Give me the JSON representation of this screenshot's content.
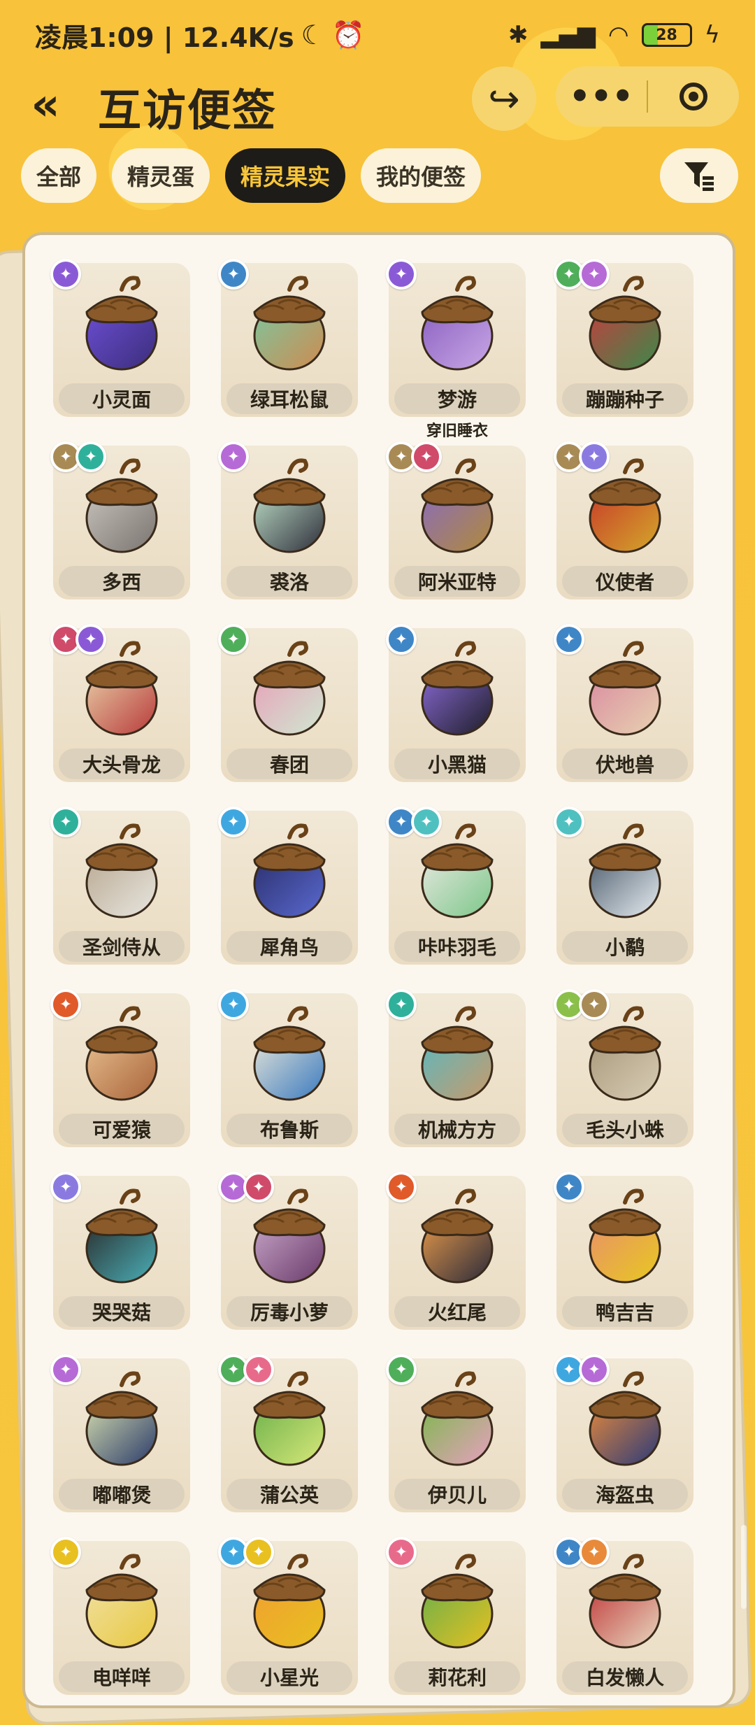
{
  "status_bar": {
    "time_text": "凌晨1:09 | 12.4K/s",
    "battery": "28",
    "icons": [
      "moon-icon",
      "alarm-icon",
      "bluetooth-icon",
      "signal-icon",
      "wifi-icon",
      "charging-icon"
    ]
  },
  "header": {
    "title": "互访便签",
    "back_icon": "«",
    "share_icon": "↪",
    "more_icon": "•••"
  },
  "tabs": [
    {
      "label": "全部",
      "active": false
    },
    {
      "label": "精灵蛋",
      "active": false
    },
    {
      "label": "精灵果实",
      "active": true
    },
    {
      "label": "我的便签",
      "active": false
    }
  ],
  "items": [
    {
      "name": "小灵面",
      "badges": [
        "#8a5ad6"
      ],
      "colors": [
        "#3b2e7a",
        "#6d4fd6"
      ],
      "note": ""
    },
    {
      "name": "绿耳松鼠",
      "badges": [
        "#3f86c6"
      ],
      "colors": [
        "#cf8a4f",
        "#7cc7a0"
      ],
      "note": ""
    },
    {
      "name": "梦游",
      "badges": [
        "#8a5ad6"
      ],
      "colors": [
        "#c9a8e6",
        "#8a5fc0"
      ],
      "note": "穿旧睡衣"
    },
    {
      "name": "蹦蹦种子",
      "badges": [
        "#4fae5a",
        "#b66ad6"
      ],
      "colors": [
        "#3a8a4a",
        "#c43e3e"
      ],
      "note": ""
    },
    {
      "name": "多西",
      "badges": [
        "#a88a55",
        "#2fb09a"
      ],
      "colors": [
        "#7a7470",
        "#c9c4bd"
      ],
      "note": ""
    },
    {
      "name": "裘洛",
      "badges": [
        "#b66ad6"
      ],
      "colors": [
        "#2e2e3a",
        "#bfe0c9"
      ],
      "note": ""
    },
    {
      "name": "阿米亚特",
      "badges": [
        "#a88a55",
        "#d04a6a"
      ],
      "colors": [
        "#b08a3a",
        "#8a6bbd"
      ],
      "note": ""
    },
    {
      "name": "仪使者",
      "badges": [
        "#a88a55",
        "#8a7ae0"
      ],
      "colors": [
        "#d4a82a",
        "#c73a2a"
      ],
      "note": ""
    },
    {
      "name": "大头骨龙",
      "badges": [
        "#d04a6a",
        "#8a5ad6"
      ],
      "colors": [
        "#b83a3a",
        "#e8cfa8"
      ],
      "note": ""
    },
    {
      "name": "春团",
      "badges": [
        "#4fae5a"
      ],
      "colors": [
        "#cfe8d1",
        "#e8a0b8"
      ],
      "note": ""
    },
    {
      "name": "小黑猫",
      "badges": [
        "#3f86c6"
      ],
      "colors": [
        "#1e1e28",
        "#8a6ad6"
      ],
      "note": ""
    },
    {
      "name": "伏地兽",
      "badges": [
        "#3f86c6"
      ],
      "colors": [
        "#e8d2b0",
        "#d98aa0"
      ],
      "note": ""
    },
    {
      "name": "圣剑侍从",
      "badges": [
        "#2fb09a"
      ],
      "colors": [
        "#e8e6e0",
        "#b8a890"
      ],
      "note": ""
    },
    {
      "name": "犀角鸟",
      "badges": [
        "#3fa7e0"
      ],
      "colors": [
        "#5a6ad0",
        "#2a2e6a"
      ],
      "note": ""
    },
    {
      "name": "咔咔羽毛",
      "badges": [
        "#3f86c6",
        "#4fc0c0"
      ],
      "colors": [
        "#7cc78a",
        "#e8e8e0"
      ],
      "note": ""
    },
    {
      "name": "小鹬",
      "badges": [
        "#4fc0c0"
      ],
      "colors": [
        "#e8eef2",
        "#4a5a6a"
      ],
      "note": ""
    },
    {
      "name": "可爱猿",
      "badges": [
        "#e05a2a"
      ],
      "colors": [
        "#a8643a",
        "#e8c090"
      ],
      "note": ""
    },
    {
      "name": "布鲁斯",
      "badges": [
        "#3fa7e0"
      ],
      "colors": [
        "#3a7ac0",
        "#e8e6d8"
      ],
      "note": ""
    },
    {
      "name": "机械方方",
      "badges": [
        "#2fb09a"
      ],
      "colors": [
        "#c99a6a",
        "#5ab8c0"
      ],
      "note": ""
    },
    {
      "name": "毛头小蛛",
      "badges": [
        "#8ac04a",
        "#a88a55"
      ],
      "colors": [
        "#d8cdb5",
        "#a8987a"
      ],
      "note": ""
    },
    {
      "name": "哭哭菇",
      "badges": [
        "#8a7ae0"
      ],
      "colors": [
        "#4ab0b8",
        "#2a2a2a"
      ],
      "note": ""
    },
    {
      "name": "厉毒小萝",
      "badges": [
        "#b66ad6",
        "#d04a6a"
      ],
      "colors": [
        "#6a3a6a",
        "#c9a8c9"
      ],
      "note": ""
    },
    {
      "name": "火红尾",
      "badges": [
        "#e05a2a"
      ],
      "colors": [
        "#2a2a3a",
        "#e89a4a"
      ],
      "note": ""
    },
    {
      "name": "鸭吉吉",
      "badges": [
        "#3f86c6"
      ],
      "colors": [
        "#e8c820",
        "#e8906a"
      ],
      "note": ""
    },
    {
      "name": "嘟嘟煲",
      "badges": [
        "#b66ad6"
      ],
      "colors": [
        "#2a3a6a",
        "#d8e0b0"
      ],
      "note": ""
    },
    {
      "name": "蒲公英",
      "badges": [
        "#4fae5a",
        "#e86a8a"
      ],
      "colors": [
        "#d8e87a",
        "#6ab04a"
      ],
      "note": ""
    },
    {
      "name": "伊贝儿",
      "badges": [
        "#4fae5a"
      ],
      "colors": [
        "#e8a0c0",
        "#7ab84a"
      ],
      "note": ""
    },
    {
      "name": "海盔虫",
      "badges": [
        "#3fa7e0",
        "#b66ad6"
      ],
      "colors": [
        "#2a3a7a",
        "#e88a3a"
      ],
      "note": ""
    },
    {
      "name": "电咩咩",
      "badges": [
        "#e8c020"
      ],
      "colors": [
        "#e8c840",
        "#f0e0a0"
      ],
      "note": ""
    },
    {
      "name": "小星光",
      "badges": [
        "#3fa7e0",
        "#e8c020"
      ],
      "colors": [
        "#e8c020",
        "#f0a030"
      ],
      "note": ""
    },
    {
      "name": "莉花利",
      "badges": [
        "#e86a8a"
      ],
      "colors": [
        "#e8c020",
        "#6ab04a"
      ],
      "note": ""
    },
    {
      "name": "白发懒人",
      "badges": [
        "#3f86c6",
        "#e88a3a"
      ],
      "colors": [
        "#e8d8c0",
        "#c03a3a"
      ],
      "note": ""
    }
  ]
}
